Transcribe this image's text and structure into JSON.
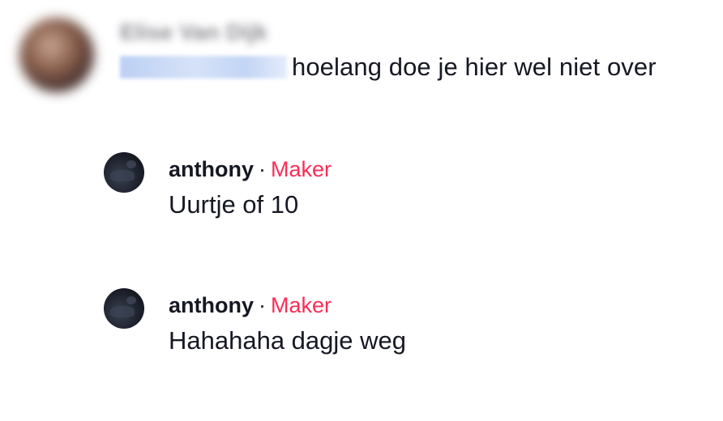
{
  "parent_comment": {
    "username": "Elise Van Dijk",
    "mention": "@annadh23012",
    "text": "hoelang doe je hier wel niet over"
  },
  "replies": [
    {
      "username": "anthony",
      "separator": "·",
      "badge": "Maker",
      "text": "Uurtje of 10"
    },
    {
      "username": "anthony",
      "separator": "·",
      "badge": "Maker",
      "text": "Hahahaha dagje weg"
    }
  ],
  "colors": {
    "text": "#161823",
    "badge": "#fe2c55",
    "mention": "#2b5bd7"
  }
}
